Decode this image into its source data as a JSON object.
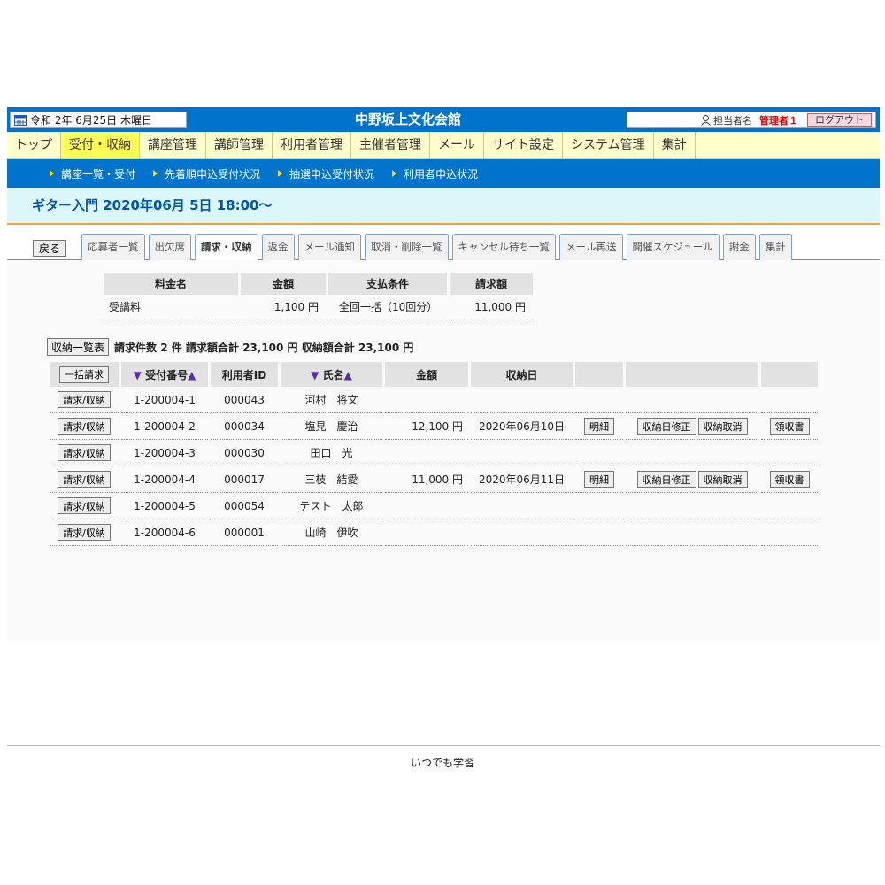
{
  "header": {
    "date": "令和 2年 6月25日 木曜日",
    "site_title": "中野坂上文化会館",
    "user_label": "担当者名",
    "user_name": "管理者１",
    "logout_label": "ログアウト"
  },
  "main_nav": [
    {
      "label": "トップ"
    },
    {
      "label": "受付・収納"
    },
    {
      "label": "講座管理"
    },
    {
      "label": "講師管理"
    },
    {
      "label": "利用者管理"
    },
    {
      "label": "主催者管理"
    },
    {
      "label": "メール"
    },
    {
      "label": "サイト設定"
    },
    {
      "label": "システム管理"
    },
    {
      "label": "集計"
    }
  ],
  "sub_nav": [
    {
      "label": "講座一覧・受付"
    },
    {
      "label": "先着順申込受付状況"
    },
    {
      "label": "抽選申込受付状況"
    },
    {
      "label": "利用者申込状況"
    }
  ],
  "course_title": "ギター入門 2020年06月 5日 18:00～",
  "back_label": "戻る",
  "tabs": [
    {
      "label": "応募者一覧"
    },
    {
      "label": "出欠席"
    },
    {
      "label": "請求・収納"
    },
    {
      "label": "返金"
    },
    {
      "label": "メール通知"
    },
    {
      "label": "取消・削除一覧"
    },
    {
      "label": "キャンセル待ち一覧"
    },
    {
      "label": "メール再送"
    },
    {
      "label": "開催スケジュール"
    },
    {
      "label": "謝金"
    },
    {
      "label": "集計"
    }
  ],
  "fee_table": {
    "headers": [
      "料金名",
      "金額",
      "支払条件",
      "請求額"
    ],
    "row": {
      "name": "受講料",
      "amount": "1,100 円",
      "condition": "全回一括（10回分）",
      "bill": "11,000 円"
    }
  },
  "summary": {
    "button_label": "収納一覧表",
    "text": "請求件数 2 件  請求額合計 23,100 円  収納額合計 23,100 円"
  },
  "list": {
    "bulk_button": "一括請求",
    "headers": {
      "no": "受付番号",
      "uid": "利用者ID",
      "name": "氏名",
      "amount": "金額",
      "date": "収納日"
    },
    "sort_down": "▼",
    "sort_up": "▲",
    "row_button": "請求/収納",
    "detail_button": "明細",
    "fix_button": "収納日修正",
    "cancel_button": "収納取消",
    "receipt_button": "領収書",
    "rows": [
      {
        "no": "1-200004-1",
        "uid": "000043",
        "name": "河村　将文",
        "amount": "",
        "date": ""
      },
      {
        "no": "1-200004-2",
        "uid": "000034",
        "name": "塩見　慶治",
        "amount": "12,100 円",
        "date": "2020年06月10日"
      },
      {
        "no": "1-200004-3",
        "uid": "000030",
        "name": "田口　光",
        "amount": "",
        "date": ""
      },
      {
        "no": "1-200004-4",
        "uid": "000017",
        "name": "三枝　結愛",
        "amount": "11,000 円",
        "date": "2020年06月11日"
      },
      {
        "no": "1-200004-5",
        "uid": "000054",
        "name": "テスト　太郎",
        "amount": "",
        "date": ""
      },
      {
        "no": "1-200004-6",
        "uid": "000001",
        "name": "山崎　伊吹",
        "amount": "",
        "date": ""
      }
    ]
  },
  "footer": "いつでも学習",
  "colors": {
    "header_blue": "#0073cc",
    "nav_yellow": "#ffffcc",
    "nav_active": "#ffff55",
    "title_blue": "#0055aa"
  }
}
